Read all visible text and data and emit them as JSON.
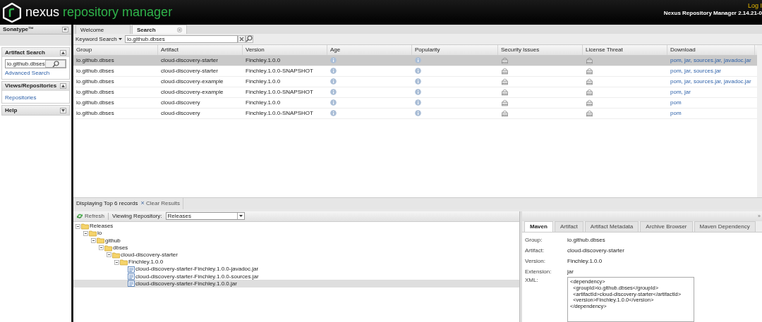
{
  "header": {
    "logo_word": "nexus",
    "logo_rest": "repository manager",
    "login": "Log I",
    "version": "Nexus Repository Manager 2.14.21-0"
  },
  "sidebar": {
    "title": "Sonatype™",
    "collapse": "«",
    "panels": [
      {
        "title": "Artifact Search",
        "expanded": true,
        "search_value": "io.github.dbses",
        "links": [
          "Advanced Search"
        ]
      },
      {
        "title": "Views/Repositories",
        "expanded": true,
        "links": [
          "Repositories"
        ]
      },
      {
        "title": "Help",
        "expanded": false
      }
    ]
  },
  "tabs": [
    {
      "label": "Welcome",
      "selected": false,
      "closable": false
    },
    {
      "label": "Search",
      "selected": true,
      "closable": true
    }
  ],
  "search_toolbar": {
    "mode": "Keyword Search",
    "value": "io.github.dbses"
  },
  "table": {
    "columns": [
      "Group",
      "Artifact",
      "Version",
      "Age",
      "Popularity",
      "Security Issues",
      "License Threat",
      "Download"
    ],
    "rows": [
      {
        "group": "io.github.dbses",
        "artifact": "cloud-discovery-starter",
        "version": "Finchley.1.0.0",
        "download": "pom, jar, sources.jar, javadoc.jar",
        "selected": true
      },
      {
        "group": "io.github.dbses",
        "artifact": "cloud-discovery-starter",
        "version": "Finchley.1.0.0-SNAPSHOT",
        "download": "pom, jar, sources.jar",
        "selected": false
      },
      {
        "group": "io.github.dbses",
        "artifact": "cloud-discovery-example",
        "version": "Finchley.1.0.0",
        "download": "pom, jar, sources.jar, javadoc.jar",
        "selected": false
      },
      {
        "group": "io.github.dbses",
        "artifact": "cloud-discovery-example",
        "version": "Finchley.1.0.0-SNAPSHOT",
        "download": "pom, jar",
        "selected": false
      },
      {
        "group": "io.github.dbses",
        "artifact": "cloud-discovery",
        "version": "Finchley.1.0.0",
        "download": "pom",
        "selected": false
      },
      {
        "group": "io.github.dbses",
        "artifact": "cloud-discovery",
        "version": "Finchley.1.0.0-SNAPSHOT",
        "download": "pom",
        "selected": false
      }
    ]
  },
  "status_bar": {
    "text": "Displaying Top 6 records",
    "clear": "Clear Results",
    "clear_icon": "×"
  },
  "browser": {
    "refresh": "Refresh",
    "repo_label": "Viewing Repository:",
    "repo_value": "Releases",
    "tree": [
      {
        "label": "Releases",
        "kind": "folder",
        "expanded": true,
        "selected": false,
        "children": [
          {
            "label": "io",
            "kind": "folder",
            "expanded": true,
            "selected": false,
            "children": [
              {
                "label": "github",
                "kind": "folder",
                "expanded": true,
                "selected": false,
                "children": [
                  {
                    "label": "dbses",
                    "kind": "folder",
                    "expanded": true,
                    "selected": false,
                    "children": [
                      {
                        "label": "cloud-discovery-starter",
                        "kind": "folder",
                        "expanded": true,
                        "selected": false,
                        "children": [
                          {
                            "label": "Finchley.1.0.0",
                            "kind": "folder",
                            "expanded": true,
                            "selected": false,
                            "children": [
                              {
                                "label": "cloud-discovery-starter-Finchley.1.0.0-javadoc.jar",
                                "kind": "file",
                                "selected": false
                              },
                              {
                                "label": "cloud-discovery-starter-Finchley.1.0.0-sources.jar",
                                "kind": "file",
                                "selected": false
                              },
                              {
                                "label": "cloud-discovery-starter-Finchley.1.0.0.jar",
                                "kind": "file",
                                "selected": true
                              }
                            ]
                          }
                        ]
                      }
                    ]
                  }
                ]
              }
            ]
          }
        ]
      }
    ]
  },
  "details": {
    "collapse": "»",
    "tabs": [
      {
        "label": "Maven",
        "selected": true
      },
      {
        "label": "Artifact",
        "selected": false
      },
      {
        "label": "Artifact Metadata",
        "selected": false
      },
      {
        "label": "Archive Browser",
        "selected": false
      },
      {
        "label": "Maven Dependency",
        "selected": false
      }
    ],
    "fields": [
      {
        "label": "Group:",
        "value": "io.github.dbses"
      },
      {
        "label": "Artifact:",
        "value": "cloud-discovery-starter"
      },
      {
        "label": "Version:",
        "value": "Finchley.1.0.0"
      },
      {
        "label": "Extension:",
        "value": "jar"
      }
    ],
    "xml_label": "XML:",
    "xml": "<dependency>\n  <groupId>io.github.dbses</groupId>\n  <artifactId>cloud-discovery-starter</artifactId>\n  <version>Finchley.1.0.0</version>\n</dependency>"
  }
}
